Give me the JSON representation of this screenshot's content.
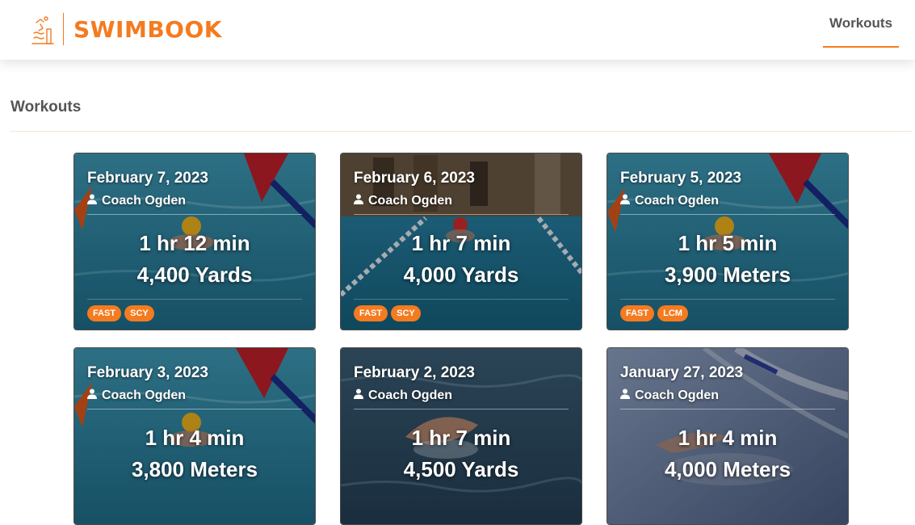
{
  "header": {
    "brand_name": "SWIMBOOK",
    "nav": {
      "workouts_label": "Workouts"
    },
    "accent_color": "#f47b20"
  },
  "page": {
    "title": "Workouts"
  },
  "workouts": [
    {
      "date": "February 7, 2023",
      "coach": "Coach Ogden",
      "duration": "1 hr 12 min",
      "distance": "4,400 Yards",
      "tags": [
        "FAST",
        "SCY"
      ]
    },
    {
      "date": "February 6, 2023",
      "coach": "Coach Ogden",
      "duration": "1 hr 7 min",
      "distance": "4,000 Yards",
      "tags": [
        "FAST",
        "SCY"
      ]
    },
    {
      "date": "February 5, 2023",
      "coach": "Coach Ogden",
      "duration": "1 hr 5 min",
      "distance": "3,900 Meters",
      "tags": [
        "FAST",
        "LCM"
      ]
    },
    {
      "date": "February 3, 2023",
      "coach": "Coach Ogden",
      "duration": "1 hr 4 min",
      "distance": "3,800 Meters",
      "tags": []
    },
    {
      "date": "February 2, 2023",
      "coach": "Coach Ogden",
      "duration": "1 hr 7 min",
      "distance": "4,500 Yards",
      "tags": []
    },
    {
      "date": "January 27, 2023",
      "coach": "Coach Ogden",
      "duration": "1 hr 4 min",
      "distance": "4,000 Meters",
      "tags": []
    }
  ],
  "icons": {
    "brand": "swimmer-logo-icon",
    "coach": "user-icon"
  }
}
